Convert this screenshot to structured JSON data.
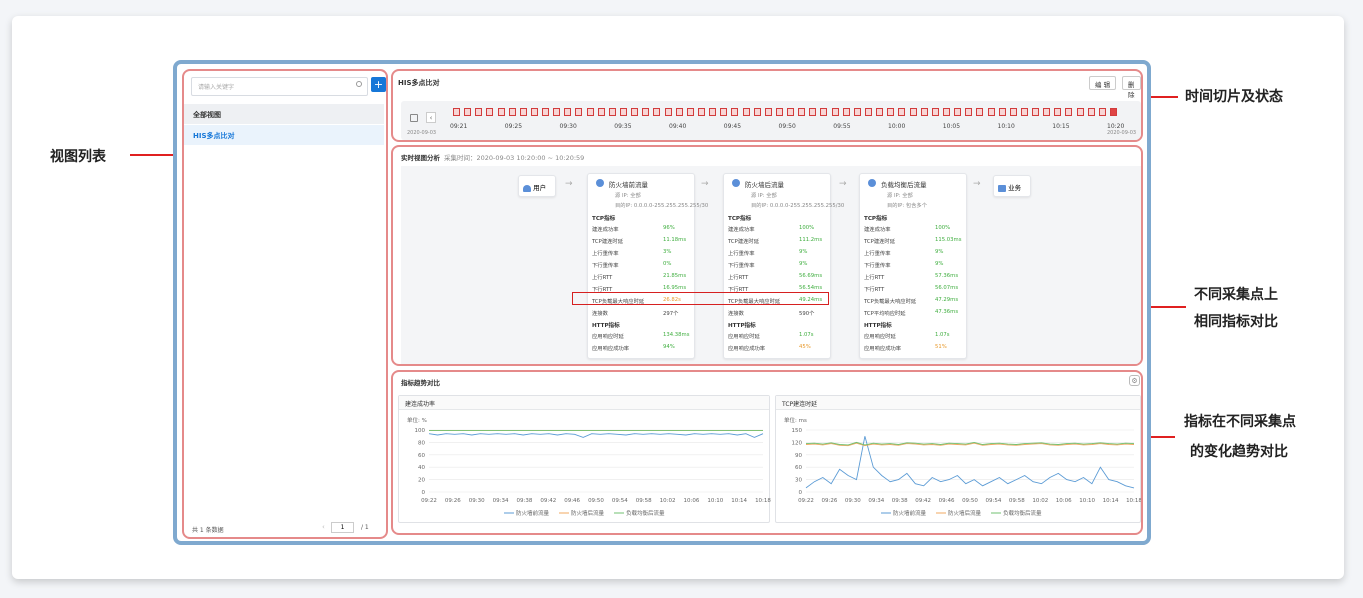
{
  "callouts": {
    "view_list": "视图列表",
    "time_slice": "时间切片及状态",
    "same_metric_1": "不同采集点上",
    "same_metric_2": "相同指标对比",
    "trend_1": "指标在不同采集点",
    "trend_2": "的变化趋势对比"
  },
  "sidebar": {
    "search_placeholder": "请输入关键字",
    "add_label": "+",
    "items": [
      {
        "label": "全部视图"
      },
      {
        "label": "HIS多点比对"
      }
    ],
    "footer_count": "共 1 条数据",
    "page_input": "1",
    "page_total": "/  1"
  },
  "timeline": {
    "title": "HIS多点比对",
    "edit_label": "编 辑",
    "delete_label": "删 除",
    "date_left": "2020-09-03",
    "date_right": "2020-09-03",
    "ticks": [
      "09:21",
      "09:25",
      "09:30",
      "09:35",
      "09:40",
      "09:45",
      "09:50",
      "09:55",
      "10:00",
      "10:05",
      "10:10",
      "10:15",
      "10:20"
    ]
  },
  "analysis": {
    "title": "实时视图分析",
    "time_range": "采集时间：2020-09-03 10:20:00 ~ 10:20:59",
    "user_label": "用户",
    "business_label": "业务",
    "nodes": [
      {
        "name": "防火墙前流量",
        "src": "源    IP: 全部",
        "dst": "目的IP: 0.0.0.0-255.255.255.255/30",
        "tcp_title": "TCP指标",
        "tcp": [
          [
            "建连成功率",
            "96%",
            "green"
          ],
          [
            "TCP建连时延",
            "11.18ms",
            "green"
          ],
          [
            "上行重传率",
            "3%",
            "green"
          ],
          [
            "下行重传率",
            "0%",
            "green"
          ],
          [
            "上行RTT",
            "21.85ms",
            "green"
          ],
          [
            "下行RTT",
            "16.95ms",
            "green"
          ],
          [
            "TCP负载最大响应时延",
            "26.82s",
            "orange"
          ],
          [
            "连接数",
            "297个",
            "plain"
          ]
        ],
        "http_title": "HTTP指标",
        "http": [
          [
            "应用响应时延",
            "134.38ms",
            "green"
          ],
          [
            "应用响应成功率",
            "94%",
            "green"
          ]
        ]
      },
      {
        "name": "防火墙后流量",
        "src": "源    IP: 全部",
        "dst": "目的IP: 0.0.0.0-255.255.255.255/30",
        "tcp_title": "TCP指标",
        "tcp": [
          [
            "建连成功率",
            "100%",
            "green"
          ],
          [
            "TCP建连时延",
            "111.2ms",
            "green"
          ],
          [
            "上行重传率",
            "9%",
            "green"
          ],
          [
            "下行重传率",
            "9%",
            "green"
          ],
          [
            "上行RTT",
            "56.69ms",
            "green"
          ],
          [
            "下行RTT",
            "56.54ms",
            "green"
          ],
          [
            "TCP负载最大响应时延",
            "49.24ms",
            "green"
          ],
          [
            "连接数",
            "590个",
            "plain"
          ]
        ],
        "http_title": "HTTP指标",
        "http": [
          [
            "应用响应时延",
            "1.07s",
            "green"
          ],
          [
            "应用响应成功率",
            "45%",
            "orange"
          ]
        ]
      },
      {
        "name": "负载均衡后流量",
        "src": "源    IP: 全部",
        "dst": "目的IP: 包含多个",
        "tcp_title": "TCP指标",
        "tcp": [
          [
            "建连成功率",
            "100%",
            "green"
          ],
          [
            "TCP建连时延",
            "115.03ms",
            "green"
          ],
          [
            "上行重传率",
            "9%",
            "green"
          ],
          [
            "下行重传率",
            "9%",
            "green"
          ],
          [
            "上行RTT",
            "57.36ms",
            "green"
          ],
          [
            "下行RTT",
            "56.07ms",
            "green"
          ],
          [
            "TCP负载最大响应时延",
            "47.29ms",
            "green"
          ],
          [
            "TCP平均响应时延",
            "47.36ms",
            "green"
          ]
        ],
        "http_title": "HTTP指标",
        "http": [
          [
            "应用响应时延",
            "1.07s",
            "green"
          ],
          [
            "应用响应成功率",
            "51%",
            "orange"
          ]
        ]
      }
    ]
  },
  "trend": {
    "title": "指标趋势对比",
    "legend": [
      "防火墙前流量",
      "防火墙后流量",
      "负载均衡后流量"
    ]
  },
  "chart_data": [
    {
      "type": "line",
      "title": "建连成功率",
      "unit": "单位:  %",
      "ylim": [
        0,
        100
      ],
      "yticks": [
        0,
        20,
        40,
        60,
        80,
        100
      ],
      "x": [
        "09:22",
        "09:26",
        "09:30",
        "09:34",
        "09:38",
        "09:42",
        "09:46",
        "09:50",
        "09:54",
        "09:58",
        "10:02",
        "10:06",
        "10:10",
        "10:14",
        "10:18"
      ],
      "series": [
        {
          "name": "防火墙前流量",
          "color": "#5b9bd5",
          "values": [
            94,
            92,
            94,
            93,
            94,
            92,
            94,
            93,
            94,
            93,
            94,
            92,
            94,
            93,
            94,
            92,
            94,
            93,
            88,
            94,
            93,
            94,
            93,
            92,
            94,
            93,
            94,
            93,
            94,
            93,
            92,
            94,
            93,
            94,
            93,
            94,
            92,
            94,
            88,
            94
          ]
        },
        {
          "name": "防火墙后流量",
          "color": "#f0a860",
          "values": [
            99,
            99,
            99,
            99,
            99,
            99,
            99,
            99,
            99,
            99,
            99,
            99,
            99,
            99,
            99,
            99,
            99,
            99,
            99,
            99,
            99,
            99,
            99,
            99,
            99,
            99,
            99,
            99,
            99,
            99,
            99,
            99,
            99,
            99,
            99,
            99,
            99,
            99,
            99,
            99
          ]
        },
        {
          "name": "负载均衡后流量",
          "color": "#70c070",
          "values": [
            99,
            99,
            99,
            99,
            99,
            99,
            99,
            99,
            99,
            99,
            99,
            99,
            99,
            99,
            99,
            99,
            99,
            99,
            99,
            99,
            99,
            99,
            99,
            99,
            99,
            99,
            99,
            99,
            99,
            99,
            99,
            99,
            99,
            99,
            99,
            99,
            99,
            99,
            99,
            99
          ]
        }
      ]
    },
    {
      "type": "line",
      "title": "TCP建连时延",
      "unit": "单位:  ms",
      "ylim": [
        0,
        150
      ],
      "yticks": [
        0,
        30,
        60,
        90,
        120,
        150
      ],
      "x": [
        "09:22",
        "09:26",
        "09:30",
        "09:34",
        "09:38",
        "09:42",
        "09:46",
        "09:50",
        "09:54",
        "09:58",
        "10:02",
        "10:06",
        "10:10",
        "10:14",
        "10:18"
      ],
      "series": [
        {
          "name": "防火墙前流量",
          "color": "#5b9bd5",
          "values": [
            10,
            25,
            35,
            20,
            55,
            40,
            30,
            135,
            60,
            40,
            25,
            30,
            45,
            20,
            15,
            35,
            25,
            30,
            40,
            20,
            30,
            15,
            25,
            35,
            20,
            30,
            40,
            25,
            20,
            35,
            45,
            30,
            25,
            35,
            20,
            60,
            30,
            25,
            15,
            10
          ]
        },
        {
          "name": "防火墙后流量",
          "color": "#f0a860",
          "values": [
            115,
            116,
            114,
            117,
            113,
            112,
            118,
            112,
            116,
            114,
            115,
            113,
            117,
            116,
            114,
            115,
            113,
            116,
            115,
            114,
            118,
            113,
            115,
            116,
            114,
            113,
            115,
            116,
            117,
            114,
            113,
            115,
            116,
            114,
            115,
            117,
            115,
            114,
            116,
            115
          ]
        },
        {
          "name": "负载均衡后流量",
          "color": "#70c070",
          "values": [
            117,
            118,
            116,
            119,
            115,
            114,
            120,
            114,
            118,
            116,
            117,
            115,
            119,
            118,
            116,
            117,
            115,
            118,
            117,
            116,
            120,
            115,
            117,
            118,
            116,
            115,
            117,
            118,
            119,
            116,
            115,
            117,
            118,
            116,
            117,
            119,
            117,
            116,
            118,
            117
          ]
        }
      ]
    }
  ]
}
